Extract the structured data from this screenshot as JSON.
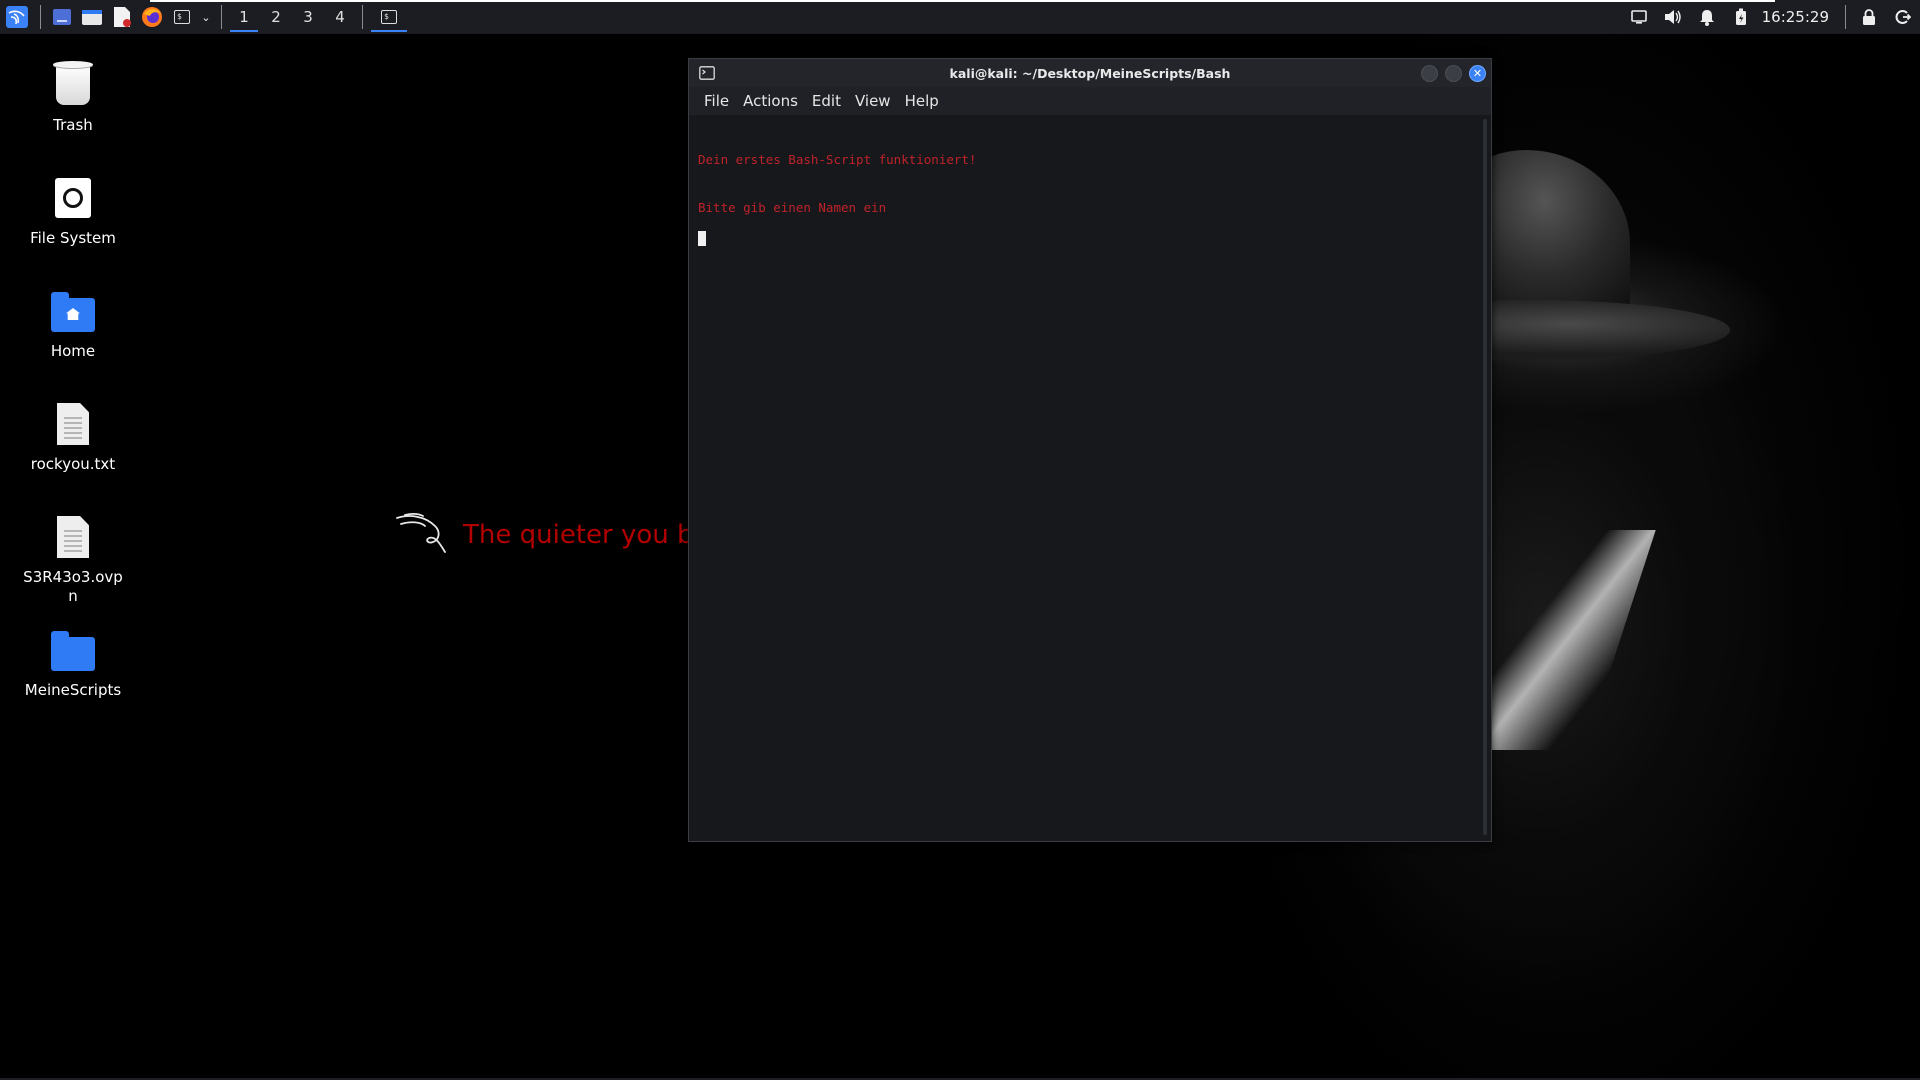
{
  "taskbar": {
    "launchers": [
      {
        "icon": "kali-menu-icon"
      },
      {
        "icon": "show-desktop-icon"
      },
      {
        "icon": "file-manager-icon"
      },
      {
        "icon": "text-editor-icon"
      },
      {
        "icon": "firefox-icon"
      },
      {
        "icon": "terminal-icon"
      }
    ],
    "workspaces": [
      "1",
      "2",
      "3",
      "4"
    ],
    "active_workspace": "1",
    "clock": "16:25:29",
    "accent_color": "#3b82f6"
  },
  "desktop_icons": [
    {
      "label": "Trash",
      "icon": "trash-icon"
    },
    {
      "label": "File System",
      "icon": "filesystem-icon"
    },
    {
      "label": "Home",
      "icon": "home-folder-icon"
    },
    {
      "label": "rockyou.txt",
      "icon": "text-file-icon"
    },
    {
      "label": "S3R43o3.ovpn",
      "icon": "text-file-icon"
    },
    {
      "label": "MeineScripts",
      "icon": "folder-icon"
    }
  ],
  "wallpaper": {
    "tagline": "The quieter you become, the more you can hear.",
    "tagline_color": "#b30000"
  },
  "terminal": {
    "title": "kali@kali: ~/Desktop/MeineScripts/Bash",
    "menu": [
      "File",
      "Actions",
      "Edit",
      "View",
      "Help"
    ],
    "lines": [
      "Dein erstes Bash-Script funktioniert!",
      "Bitte gib einen Namen ein"
    ],
    "text_color": "#c0222a"
  }
}
